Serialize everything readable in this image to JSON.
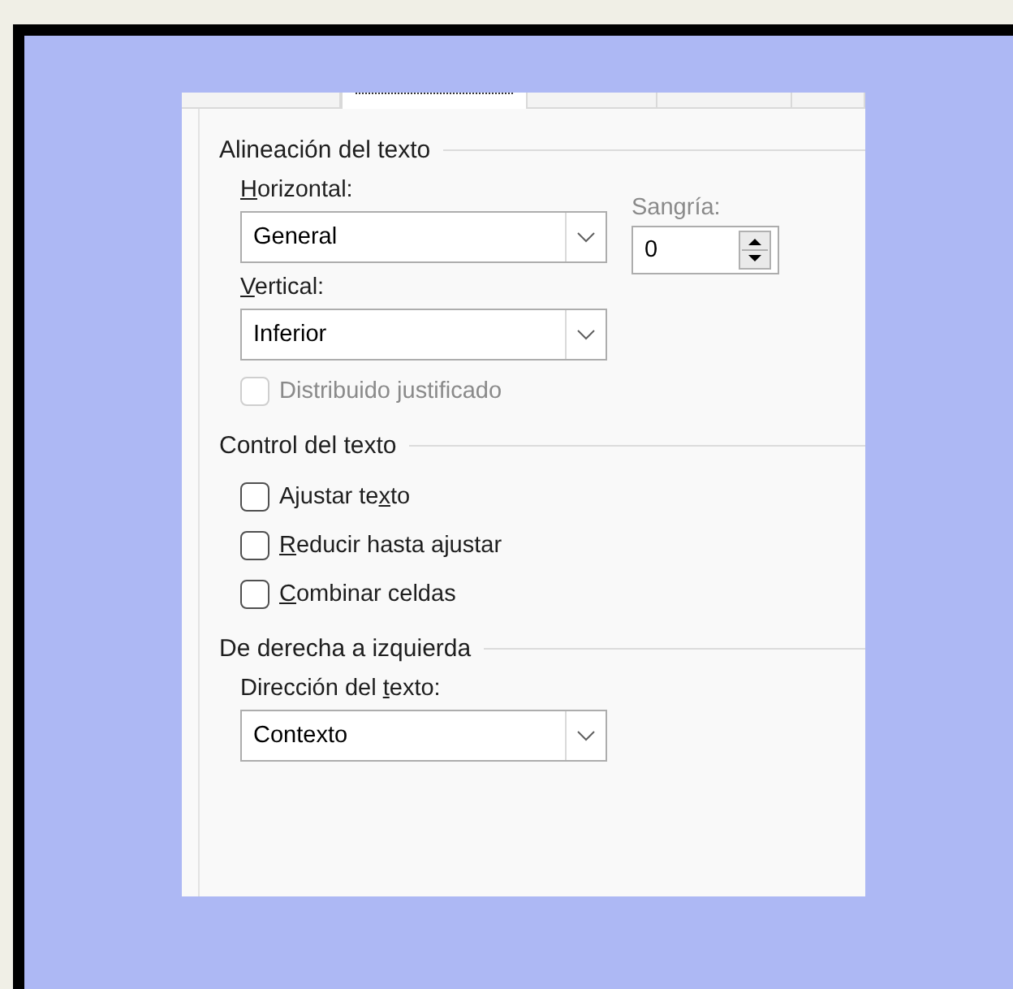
{
  "tabs": [
    {
      "selected": false
    },
    {
      "selected": true
    },
    {
      "selected": false
    },
    {
      "selected": false
    },
    {
      "selected": false
    }
  ],
  "sections": [
    {
      "title": "Alineación del texto",
      "items": [
        {
          "kind": "combo",
          "label": {
            "key": "H",
            "post": "orizontal:"
          },
          "value": "General",
          "spin": {
            "label": "Sangría:",
            "value": "0"
          }
        },
        {
          "kind": "combo",
          "label": {
            "key": "V",
            "post": "ertical:"
          },
          "value": "Inferior"
        },
        {
          "kind": "checkbox",
          "label": {
            "pre": "Distribuido justificado"
          },
          "checked": false,
          "disabled": true
        }
      ]
    },
    {
      "title": "Control del texto",
      "items": [
        {
          "kind": "checkbox",
          "label": {
            "pre": "Ajustar te",
            "key": "x",
            "post": "to"
          },
          "checked": false,
          "disabled": false
        },
        {
          "kind": "checkbox",
          "label": {
            "key": "R",
            "post": "educir hasta ajustar"
          },
          "checked": false,
          "disabled": false
        },
        {
          "kind": "checkbox",
          "label": {
            "key": "C",
            "post": "ombinar celdas"
          },
          "checked": false,
          "disabled": false
        }
      ]
    },
    {
      "title": "De derecha a izquierda",
      "items": [
        {
          "kind": "combo",
          "label": {
            "pre": "Dirección del ",
            "key": "t",
            "post": "exto:"
          },
          "value": "Contexto"
        }
      ]
    }
  ]
}
